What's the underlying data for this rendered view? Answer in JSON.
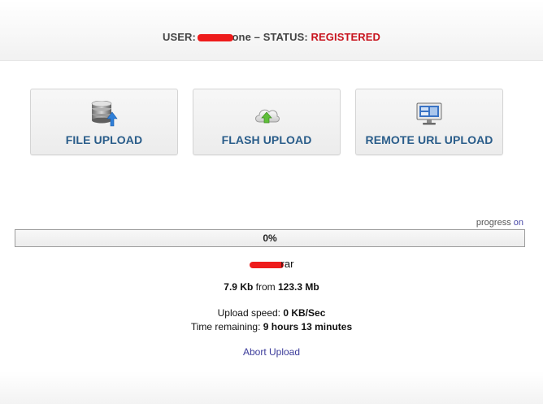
{
  "header": {
    "user_label": "USER:",
    "user_value_visible": "one",
    "separator": "–",
    "status_label": "STATUS:",
    "status_value": "REGISTERED",
    "status_color": "#c8141e"
  },
  "upload_options": [
    {
      "label": "FILE UPLOAD",
      "icon": "database-upload-icon"
    },
    {
      "label": "FLASH UPLOAD",
      "icon": "cloud-upload-icon"
    },
    {
      "label": "REMOTE URL UPLOAD",
      "icon": "monitor-icon"
    }
  ],
  "progress": {
    "toggle_label": "progress",
    "toggle_state": "on",
    "percent_text": "0%",
    "percent": 0
  },
  "file": {
    "name_visible": "rar",
    "uploaded": "7.9 Kb",
    "from_word": "from",
    "total": "123.3 Mb"
  },
  "stats": {
    "speed_label": "Upload speed:",
    "speed_value": "0 KB/Sec",
    "remaining_label": "Time remaining:",
    "remaining_value": "9 hours 13 minutes"
  },
  "actions": {
    "abort_label": "Abort Upload"
  },
  "colors": {
    "accent_text": "#2a5d8a",
    "link": "#3b3b9a"
  }
}
